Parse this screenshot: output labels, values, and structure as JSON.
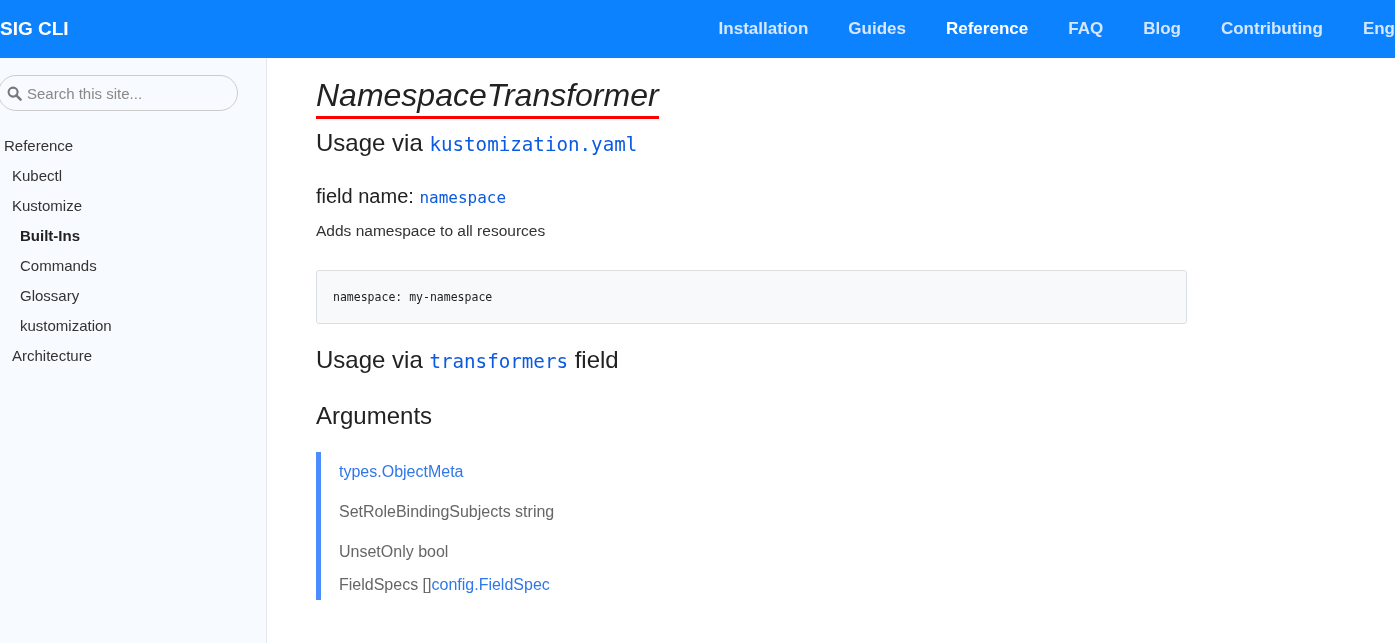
{
  "navbar": {
    "brand": "SIG CLI",
    "links": [
      {
        "label": "Installation",
        "selected": false
      },
      {
        "label": "Guides",
        "selected": false
      },
      {
        "label": "Reference",
        "selected": true
      },
      {
        "label": "FAQ",
        "selected": false
      },
      {
        "label": "Blog",
        "selected": false
      },
      {
        "label": "Contributing",
        "selected": false
      },
      {
        "label": "Eng",
        "selected": false
      }
    ]
  },
  "sidebar": {
    "search": {
      "placeholder": "Search this site..."
    },
    "items": [
      {
        "label": "Reference",
        "selected": false,
        "children": [
          {
            "label": "Kubectl",
            "selected": false
          },
          {
            "label": "Kustomize",
            "selected": false,
            "children": [
              {
                "label": "Built-Ins",
                "selected": true
              },
              {
                "label": "Commands",
                "selected": false
              },
              {
                "label": "Glossary",
                "selected": false
              },
              {
                "label": "kustomization",
                "selected": false
              }
            ]
          },
          {
            "label": "Architecture",
            "selected": false
          }
        ]
      }
    ]
  },
  "content": {
    "title": {
      "text": "NamespaceTransformer",
      "underlined": true
    },
    "blocks": [
      {
        "kind": "heading",
        "parts": [
          {
            "text": "Usage via ",
            "code": false
          },
          {
            "text": "kustomization.yaml",
            "code": true
          }
        ]
      },
      {
        "kind": "subheading",
        "parts": [
          {
            "text": "field name: ",
            "code": false
          },
          {
            "text": "namespace",
            "code": true
          }
        ]
      },
      {
        "kind": "paragraph",
        "text": "Adds namespace to all resources"
      },
      {
        "kind": "codeblock",
        "text": "namespace: my-namespace"
      },
      {
        "kind": "heading",
        "parts": [
          {
            "text": "Usage via ",
            "code": false
          },
          {
            "text": "transformers",
            "code": true
          },
          {
            "text": " field",
            "code": false
          }
        ]
      },
      {
        "kind": "heading",
        "parts": [
          {
            "text": "Arguments",
            "code": false
          }
        ]
      },
      {
        "kind": "quote",
        "items": [
          [
            {
              "text": "types.ObjectMeta",
              "link": true
            }
          ],
          [
            {
              "text": "SetRoleBindingSubjects string",
              "link": false
            }
          ],
          [
            {
              "text": "UnsetOnly bool",
              "link": false
            }
          ],
          [
            {
              "text": "FieldSpecs []",
              "link": false
            },
            {
              "text": "config.FieldSpec",
              "link": true
            }
          ]
        ]
      }
    ]
  }
}
